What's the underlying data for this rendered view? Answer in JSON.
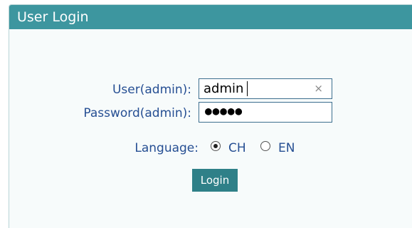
{
  "header": {
    "title": "User Login"
  },
  "form": {
    "user_label": "User(admin):",
    "user_value": "admin",
    "clear_symbol": "×",
    "password_label": "Password(admin):",
    "password_mask": "●●●●●",
    "language_label": "Language:",
    "language_options": [
      {
        "label": "CH",
        "selected": true
      },
      {
        "label": "EN",
        "selected": false
      }
    ],
    "login_label": "Login"
  },
  "colors": {
    "titlebar": "#3d969f",
    "label_text": "#264f93",
    "button": "#2f8088"
  }
}
